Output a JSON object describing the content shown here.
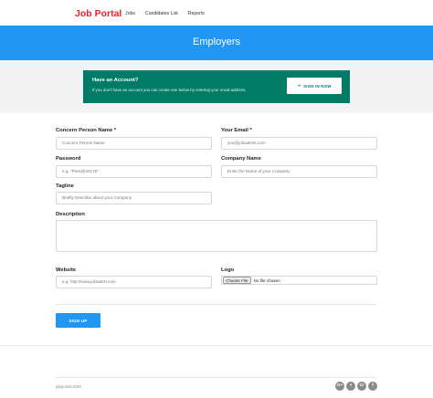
{
  "header": {
    "logo": "Job Portal",
    "nav": [
      "Jobs",
      "Candidates List",
      "Reports"
    ]
  },
  "banner": {
    "title": "Employers"
  },
  "account": {
    "title": "Have an Account?",
    "subtitle": "If you don't have an account you can create one below by entering your email address.",
    "signin_label": "SIGN IN NOW",
    "signin_icon": "sign-in-arrow-icon"
  },
  "form": {
    "contact_label": "Concern Person Name *",
    "contact_placeholder": "Concern Person Name",
    "email_label": "Your Email *",
    "email_placeholder": "you@jobsalerts.com",
    "password_label": "Password",
    "password_placeholder": "e.g. \"Pass@20178\"",
    "company_label": "Company Name",
    "company_placeholder": "Enter the Name of your Company",
    "tagline_label": "Tagline",
    "tagline_placeholder": "Briefly Describe about your Company",
    "description_label": "Description",
    "website_label": "Website",
    "website_placeholder": "e.g. http://www.jobsalert.com",
    "logo_label": "Logo",
    "file_button": "Choose File",
    "file_status": "No file chosen",
    "signup_label": "SIGN UP"
  },
  "footer": {
    "copyright": "jobportal 2020",
    "social": [
      {
        "icon": "google-plus-icon",
        "glyph": "G+"
      },
      {
        "icon": "twitter-icon",
        "glyph": "t"
      },
      {
        "icon": "linkedin-icon",
        "glyph": "in"
      },
      {
        "icon": "facebook-icon",
        "glyph": "f"
      }
    ]
  },
  "colors": {
    "brand_red": "#e8212a",
    "banner_blue": "#2196f3",
    "account_green": "#007b66",
    "grey_band": "#f3f3f3"
  }
}
